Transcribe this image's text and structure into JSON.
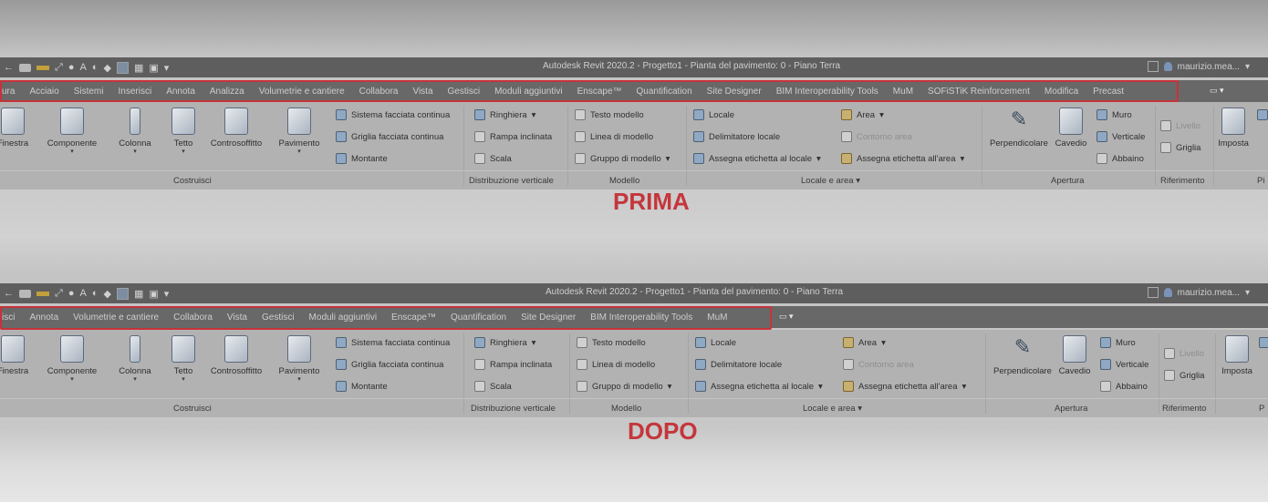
{
  "app_title": "Autodesk Revit 2020.2 - Progetto1 - Pianta del pavimento: 0 - Piano Terra",
  "user_name": "maurizio.mea...",
  "colors": {
    "highlight": "#c8323a",
    "caption": "#c4363c",
    "titlebar": "#5e5e5e",
    "tabbar": "#686868",
    "ribbon": "#b2b2b2"
  },
  "before": {
    "caption": "PRIMA",
    "tabs": [
      "ura",
      "Acciaio",
      "Sistemi",
      "Inserisci",
      "Annota",
      "Analizza",
      "Volumetrie e cantiere",
      "Collabora",
      "Vista",
      "Gestisci",
      "Moduli aggiuntivi",
      "Enscape™",
      "Quantification",
      "Site Designer",
      "BIM Interoperability Tools",
      "MuM",
      "SOFiSTiK Reinforcement",
      "Modifica",
      "Precast"
    ]
  },
  "after": {
    "caption": "DOPO",
    "tabs": [
      "isci",
      "Annota",
      "Volumetrie e cantiere",
      "Collabora",
      "Vista",
      "Gestisci",
      "Moduli aggiuntivi",
      "Enscape™",
      "Quantification",
      "Site Designer",
      "BIM Interoperability Tools",
      "MuM"
    ]
  },
  "ribbon": {
    "costruisci": {
      "label": "Costruisci",
      "finestra": "Finestra",
      "componente": "Componente",
      "colonna": "Colonna",
      "tetto": "Tetto",
      "controsoffitto": "Controsoffitto",
      "pavimento": "Pavimento",
      "sistema_facciata": "Sistema facciata continua",
      "griglia_facciata": "Griglia facciata continua",
      "montante": "Montante"
    },
    "distribuzione": {
      "label": "Distribuzione verticale",
      "ringhiera": "Ringhiera",
      "rampa": "Rampa inclinata",
      "scala": "Scala"
    },
    "modello": {
      "label": "Modello",
      "testo": "Testo modello",
      "linea": "Linea di modello",
      "gruppo": "Gruppo di modello"
    },
    "locale": {
      "label": "Locale e area",
      "locale": "Locale",
      "delimitatore": "Delimitatore locale",
      "assegna_locale": "Assegna etichetta al locale",
      "area": "Area",
      "contorno": "Contorno area",
      "assegna_area": "Assegna etichetta all'area"
    },
    "apertura": {
      "label": "Apertura",
      "perpendicolare": "Perpendicolare",
      "cavedio": "Cavedio",
      "muro": "Muro",
      "verticale": "Verticale",
      "abbaino": "Abbaino"
    },
    "riferimento": {
      "label": "Riferimento",
      "livello": "Livello",
      "griglia": "Griglia"
    },
    "imposta": "Imposta",
    "pi_label": "Pi",
    "p_label": "P"
  }
}
